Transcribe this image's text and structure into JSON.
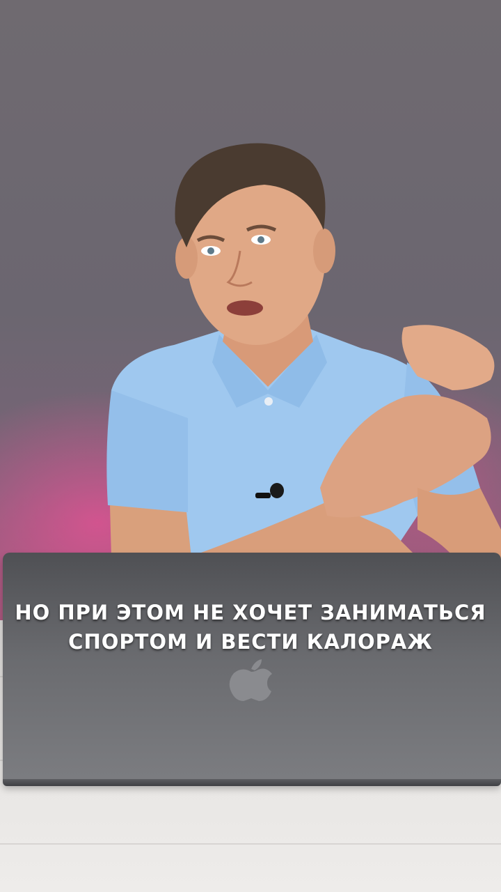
{
  "video": {
    "subtitle": {
      "line1": "НО ПРИ ЭТОМ НЕ ХОЧЕТ ЗАНИМАТЬСЯ",
      "line2": "СПОРТОМ И ВЕСТИ КАЛОРАЖ"
    },
    "colors": {
      "background_top": "#6f6a70",
      "background_glow": "#c2578a",
      "shirt": "#9ec7ef",
      "laptop": "#6a6b6f",
      "subtitle_text": "#ffffff"
    },
    "icons": [
      "apple-logo-icon",
      "lapel-microphone-icon"
    ]
  }
}
